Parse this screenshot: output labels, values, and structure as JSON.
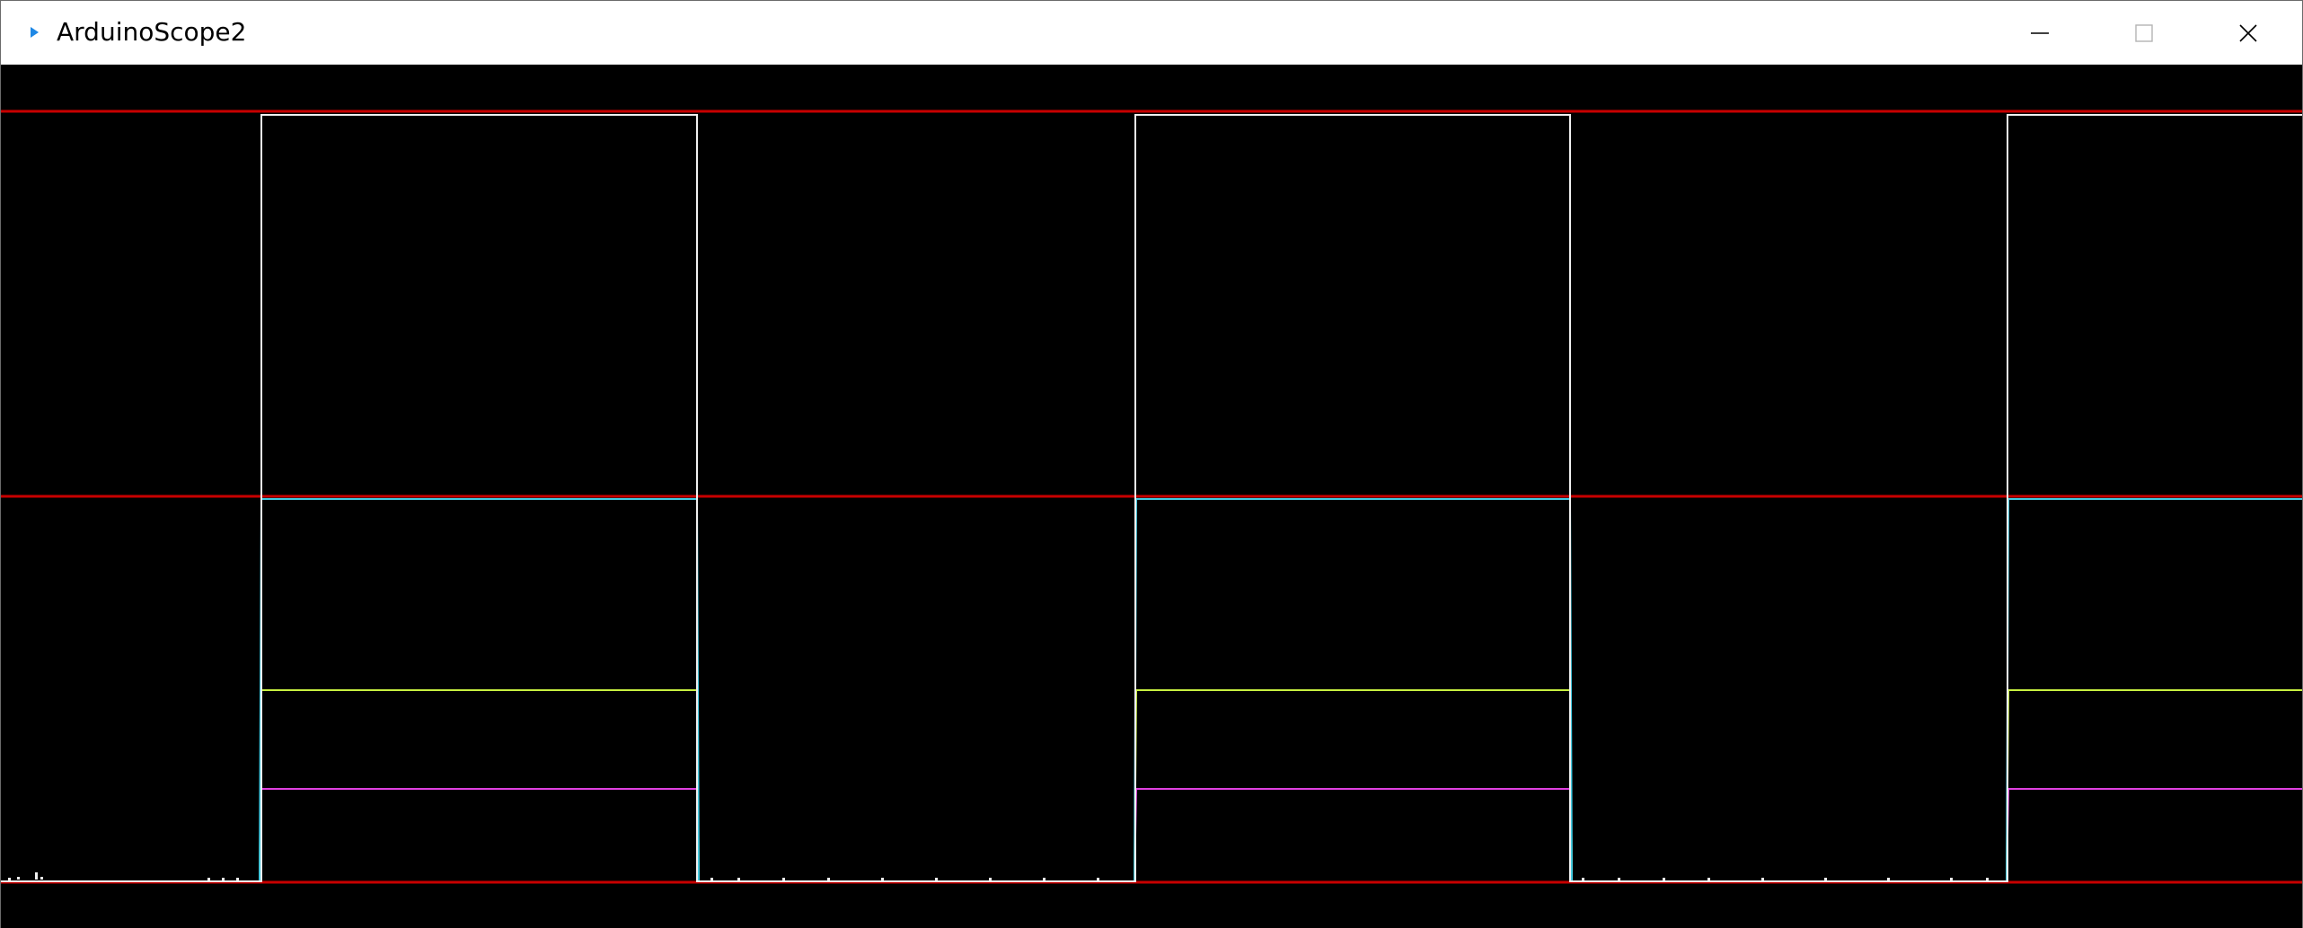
{
  "window": {
    "title": "ArduinoScope2",
    "controls": {
      "minimize_icon": "minimize-icon",
      "maximize_icon": "maximize-icon",
      "close_icon": "close-icon"
    }
  },
  "colors": {
    "background": "#000000",
    "reference_lines": "#c80000",
    "series": [
      "#ffffff",
      "#40c8e0",
      "#c8f040",
      "#e040e0"
    ]
  }
}
